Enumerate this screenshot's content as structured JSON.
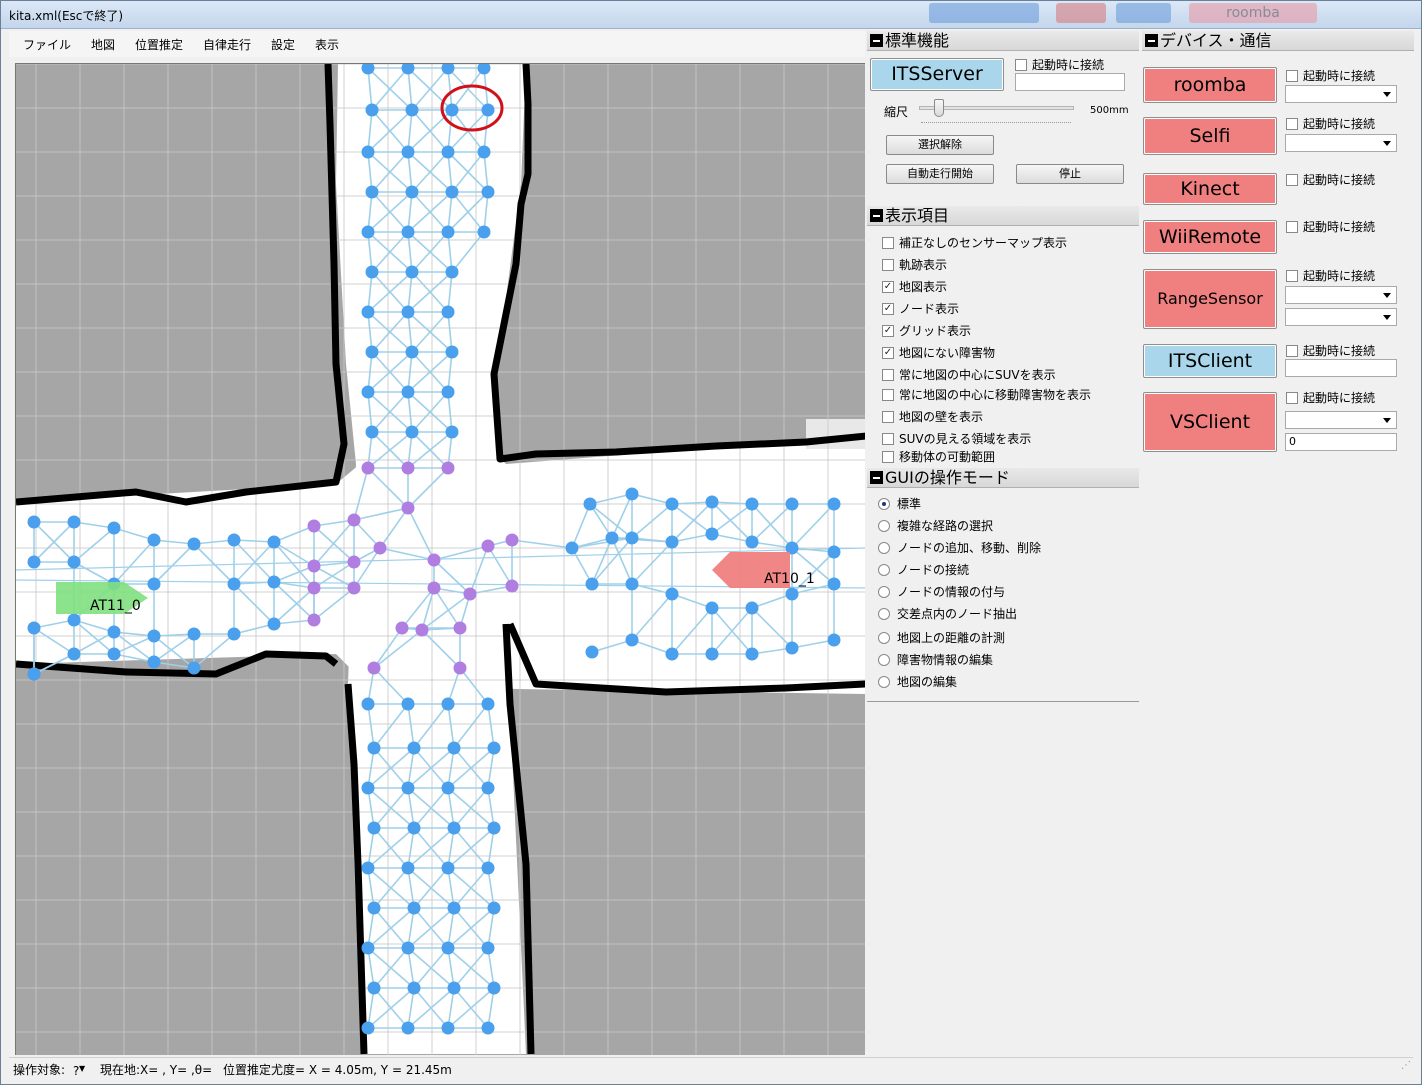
{
  "window": {
    "title": "kita.xml(Escで終了)",
    "title_tabs": [
      "roomba"
    ]
  },
  "menu": [
    "ファイル",
    "地図",
    "位置推定",
    "自律走行",
    "設定",
    "表示"
  ],
  "map": {
    "robots": [
      {
        "label": "AT11_0",
        "color": "#7fe07f"
      },
      {
        "label": "AT10_1",
        "color": "#f08080"
      }
    ],
    "colors": {
      "free": "#ffffff",
      "unknown": "#a6a6a6",
      "wall": "#000000",
      "node": "#4aa0ec",
      "node_intersection": "#b07ee0",
      "edge": "#9fd0ea",
      "grid": "#c8c8c8",
      "highlight": "#d0101a"
    }
  },
  "standard": {
    "header": "標準機能",
    "server_button": "ITSServer",
    "connect_on_start": "起動時に接続",
    "scale_label": "縮尺",
    "scale_value": "500mm",
    "clear_selection": "選択解除",
    "start_auto": "自動走行開始",
    "stop": "停止"
  },
  "display": {
    "header": "表示項目",
    "items": [
      {
        "label": "補正なしのセンサーマップ表示",
        "checked": false
      },
      {
        "label": "軌跡表示",
        "checked": false
      },
      {
        "label": "地図表示",
        "checked": true
      },
      {
        "label": "ノード表示",
        "checked": true
      },
      {
        "label": "グリッド表示",
        "checked": true
      },
      {
        "label": "地図にない障害物",
        "checked": true
      },
      {
        "label": "常に地図の中心にSUVを表示",
        "checked": false
      },
      {
        "label": "常に地図の中心に移動障害物を表示",
        "checked": false
      },
      {
        "label": "地図の壁を表示",
        "checked": false
      },
      {
        "label": "SUVの見える領域を表示",
        "checked": false
      },
      {
        "label": "移動体の可動範囲",
        "checked": false
      }
    ]
  },
  "gui_mode": {
    "header": "GUIの操作モード",
    "items": [
      {
        "label": "標準",
        "selected": true
      },
      {
        "label": "複雑な経路の選択",
        "selected": false
      },
      {
        "label": "ノードの追加、移動、削除",
        "selected": false
      },
      {
        "label": "ノードの接続",
        "selected": false
      },
      {
        "label": "ノードの情報の付与",
        "selected": false
      },
      {
        "label": "交差点内のノード抽出",
        "selected": false
      },
      {
        "label": "地図上の距離の計測",
        "selected": false
      },
      {
        "label": "障害物情報の編集",
        "selected": false
      },
      {
        "label": "地図の編集",
        "selected": false
      }
    ]
  },
  "devices": {
    "header": "デバイス・通信",
    "connect_on_start": "起動時に接続",
    "buttons": [
      {
        "label": "roomba",
        "color": "#f08080"
      },
      {
        "label": "Selfi",
        "color": "#f08080"
      },
      {
        "label": "Kinect",
        "color": "#f08080"
      },
      {
        "label": "WiiRemote",
        "color": "#f08080"
      },
      {
        "label": "RangeSensor",
        "color": "#f08080"
      },
      {
        "label": "ITSClient",
        "color": "#a9d6ea"
      },
      {
        "label": "VSClient",
        "color": "#f08080"
      }
    ],
    "vsclient_value": "0"
  },
  "status": {
    "target_label": "操作対象:",
    "target_value": "?",
    "position": "現在地:X= , Y= ,θ=",
    "likelihood": "位置推定尤度=  X = 4.05m, Y = 21.45m"
  }
}
